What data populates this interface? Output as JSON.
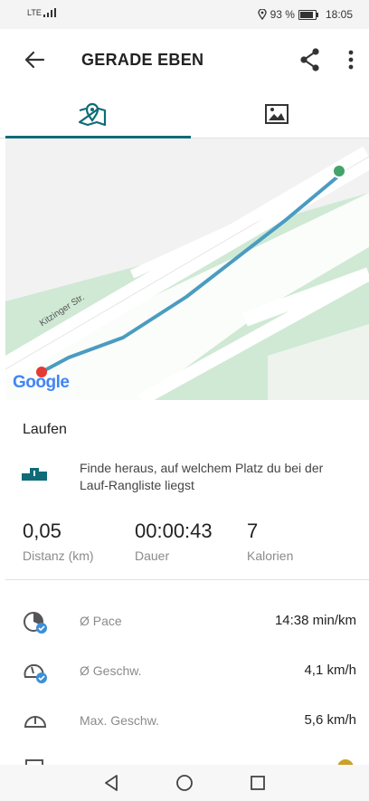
{
  "status": {
    "network": "LTE",
    "battery_percent": "93 %",
    "time": "18:05"
  },
  "header": {
    "title": "GERADE EBEN",
    "icons": [
      "arrow-back-icon",
      "share-icon",
      "more-vertical-icon"
    ]
  },
  "tabs": [
    {
      "name": "map",
      "icon": "map-pin-icon",
      "selected": true
    },
    {
      "name": "photos",
      "icon": "image-icon",
      "selected": false
    }
  ],
  "map": {
    "street_label": "Kitzinger Str.",
    "logo_text": "Google",
    "route_color": "#4a9cc0",
    "start_marker_color": "#e53935",
    "end_marker_color": "#43a36b"
  },
  "activity": {
    "type": "Laufen",
    "ranking_text": "Finde heraus, auf welchem Platz du bei der Lauf-Rangliste liegst"
  },
  "stats": [
    {
      "value": "0,05",
      "label": "Distanz (km)"
    },
    {
      "value": "00:00:43",
      "label": "Dauer"
    },
    {
      "value": "7",
      "label": "Kalorien"
    }
  ],
  "metrics": [
    {
      "icon": "pace-icon",
      "label": "Ø Pace",
      "value": "14:38 min/km"
    },
    {
      "icon": "speedometer-icon",
      "label": "Ø Geschw.",
      "value": "4,1 km/h"
    },
    {
      "icon": "gauge-icon",
      "label": "Max. Geschw.",
      "value": "5,6 km/h"
    }
  ],
  "navbar": {
    "icons": [
      "nav-back-icon",
      "nav-home-icon",
      "nav-recents-icon"
    ]
  },
  "colors": {
    "accent": "#0f6b78",
    "map_green": "#cfe9d4",
    "route": "#4a9cc0"
  }
}
